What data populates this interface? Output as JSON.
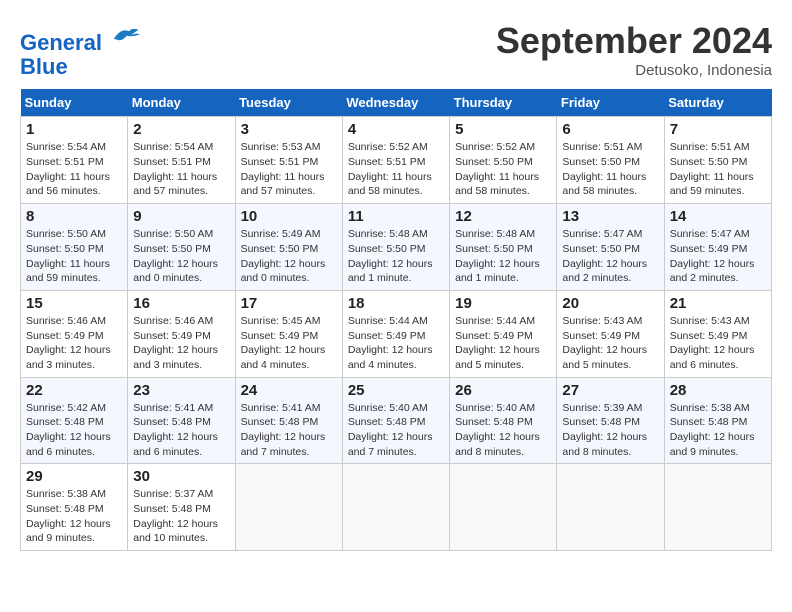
{
  "header": {
    "logo_line1": "General",
    "logo_line2": "Blue",
    "month_title": "September 2024",
    "location": "Detusoko, Indonesia"
  },
  "weekdays": [
    "Sunday",
    "Monday",
    "Tuesday",
    "Wednesday",
    "Thursday",
    "Friday",
    "Saturday"
  ],
  "weeks": [
    [
      {
        "day": "1",
        "info": "Sunrise: 5:54 AM\nSunset: 5:51 PM\nDaylight: 11 hours\nand 56 minutes."
      },
      {
        "day": "2",
        "info": "Sunrise: 5:54 AM\nSunset: 5:51 PM\nDaylight: 11 hours\nand 57 minutes."
      },
      {
        "day": "3",
        "info": "Sunrise: 5:53 AM\nSunset: 5:51 PM\nDaylight: 11 hours\nand 57 minutes."
      },
      {
        "day": "4",
        "info": "Sunrise: 5:52 AM\nSunset: 5:51 PM\nDaylight: 11 hours\nand 58 minutes."
      },
      {
        "day": "5",
        "info": "Sunrise: 5:52 AM\nSunset: 5:50 PM\nDaylight: 11 hours\nand 58 minutes."
      },
      {
        "day": "6",
        "info": "Sunrise: 5:51 AM\nSunset: 5:50 PM\nDaylight: 11 hours\nand 58 minutes."
      },
      {
        "day": "7",
        "info": "Sunrise: 5:51 AM\nSunset: 5:50 PM\nDaylight: 11 hours\nand 59 minutes."
      }
    ],
    [
      {
        "day": "8",
        "info": "Sunrise: 5:50 AM\nSunset: 5:50 PM\nDaylight: 11 hours\nand 59 minutes."
      },
      {
        "day": "9",
        "info": "Sunrise: 5:50 AM\nSunset: 5:50 PM\nDaylight: 12 hours\nand 0 minutes."
      },
      {
        "day": "10",
        "info": "Sunrise: 5:49 AM\nSunset: 5:50 PM\nDaylight: 12 hours\nand 0 minutes."
      },
      {
        "day": "11",
        "info": "Sunrise: 5:48 AM\nSunset: 5:50 PM\nDaylight: 12 hours\nand 1 minute."
      },
      {
        "day": "12",
        "info": "Sunrise: 5:48 AM\nSunset: 5:50 PM\nDaylight: 12 hours\nand 1 minute."
      },
      {
        "day": "13",
        "info": "Sunrise: 5:47 AM\nSunset: 5:50 PM\nDaylight: 12 hours\nand 2 minutes."
      },
      {
        "day": "14",
        "info": "Sunrise: 5:47 AM\nSunset: 5:49 PM\nDaylight: 12 hours\nand 2 minutes."
      }
    ],
    [
      {
        "day": "15",
        "info": "Sunrise: 5:46 AM\nSunset: 5:49 PM\nDaylight: 12 hours\nand 3 minutes."
      },
      {
        "day": "16",
        "info": "Sunrise: 5:46 AM\nSunset: 5:49 PM\nDaylight: 12 hours\nand 3 minutes."
      },
      {
        "day": "17",
        "info": "Sunrise: 5:45 AM\nSunset: 5:49 PM\nDaylight: 12 hours\nand 4 minutes."
      },
      {
        "day": "18",
        "info": "Sunrise: 5:44 AM\nSunset: 5:49 PM\nDaylight: 12 hours\nand 4 minutes."
      },
      {
        "day": "19",
        "info": "Sunrise: 5:44 AM\nSunset: 5:49 PM\nDaylight: 12 hours\nand 5 minutes."
      },
      {
        "day": "20",
        "info": "Sunrise: 5:43 AM\nSunset: 5:49 PM\nDaylight: 12 hours\nand 5 minutes."
      },
      {
        "day": "21",
        "info": "Sunrise: 5:43 AM\nSunset: 5:49 PM\nDaylight: 12 hours\nand 6 minutes."
      }
    ],
    [
      {
        "day": "22",
        "info": "Sunrise: 5:42 AM\nSunset: 5:48 PM\nDaylight: 12 hours\nand 6 minutes."
      },
      {
        "day": "23",
        "info": "Sunrise: 5:41 AM\nSunset: 5:48 PM\nDaylight: 12 hours\nand 6 minutes."
      },
      {
        "day": "24",
        "info": "Sunrise: 5:41 AM\nSunset: 5:48 PM\nDaylight: 12 hours\nand 7 minutes."
      },
      {
        "day": "25",
        "info": "Sunrise: 5:40 AM\nSunset: 5:48 PM\nDaylight: 12 hours\nand 7 minutes."
      },
      {
        "day": "26",
        "info": "Sunrise: 5:40 AM\nSunset: 5:48 PM\nDaylight: 12 hours\nand 8 minutes."
      },
      {
        "day": "27",
        "info": "Sunrise: 5:39 AM\nSunset: 5:48 PM\nDaylight: 12 hours\nand 8 minutes."
      },
      {
        "day": "28",
        "info": "Sunrise: 5:38 AM\nSunset: 5:48 PM\nDaylight: 12 hours\nand 9 minutes."
      }
    ],
    [
      {
        "day": "29",
        "info": "Sunrise: 5:38 AM\nSunset: 5:48 PM\nDaylight: 12 hours\nand 9 minutes."
      },
      {
        "day": "30",
        "info": "Sunrise: 5:37 AM\nSunset: 5:48 PM\nDaylight: 12 hours\nand 10 minutes."
      },
      {
        "day": "",
        "info": ""
      },
      {
        "day": "",
        "info": ""
      },
      {
        "day": "",
        "info": ""
      },
      {
        "day": "",
        "info": ""
      },
      {
        "day": "",
        "info": ""
      }
    ]
  ]
}
